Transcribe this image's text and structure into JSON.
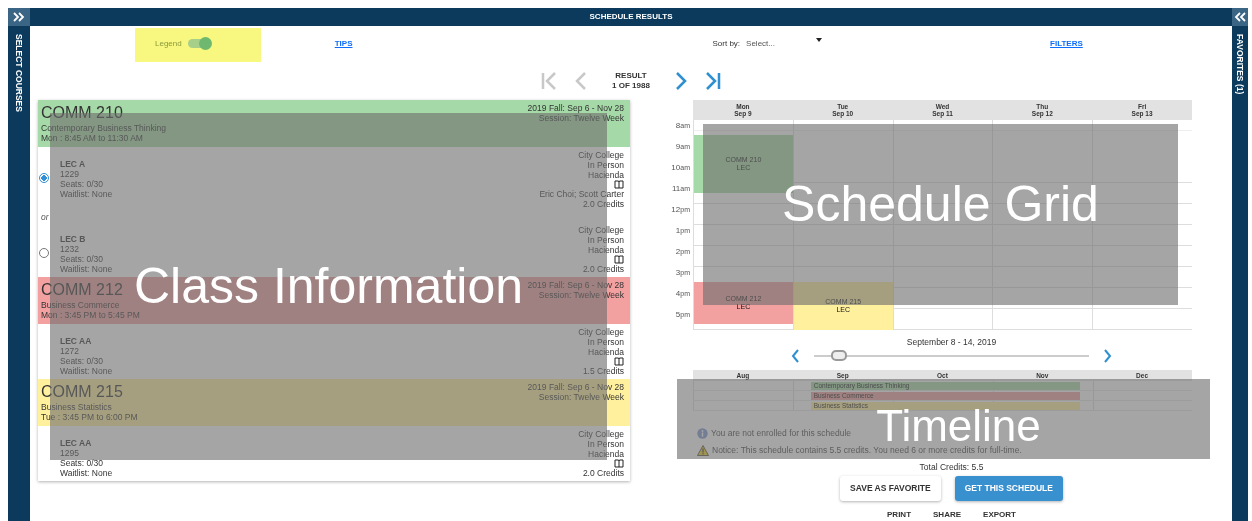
{
  "left_panel": {
    "label": "SELECT COURSES"
  },
  "header": {
    "title": "SCHEDULE RESULTS"
  },
  "right_panel": {
    "label": "FAVORITES (1)"
  },
  "toolbar": {
    "legend": {
      "label": "Legend",
      "on": true
    },
    "tips": "TIPS",
    "sort": {
      "label": "Sort by:",
      "placeholder": "Select..."
    },
    "filters": "FILTERS"
  },
  "pager": {
    "label": "RESULT",
    "count": "1 OF 1988",
    "buttons": [
      {
        "kind": "first",
        "disabled": true
      },
      {
        "kind": "prev",
        "disabled": true
      },
      {
        "kind": "next",
        "disabled": false
      },
      {
        "kind": "last",
        "disabled": false
      }
    ]
  },
  "courses": [
    {
      "code": "COMM 210",
      "title": "Contemporary Business Thinking",
      "time": "Mon : 8:45 AM to 11:30 AM",
      "term": "2019 Fall: Sep 6 - Nov 28",
      "session": "Session: Twelve Week",
      "color": "#a5d9a7",
      "or_label": "or",
      "sections": [
        {
          "name": "LEC A",
          "number": "1229",
          "seats": "Seats: 0/30",
          "waitlist": "Waitlist: None",
          "campus": "City College",
          "mode": "In Person",
          "location": "Hacienda",
          "instructors": "Eric Choi; Scott Carter",
          "credits": "2.0 Credits",
          "selected": true
        },
        {
          "name": "LEC B",
          "number": "1232",
          "seats": "Seats: 0/30",
          "waitlist": "Waitlist: None",
          "campus": "City College",
          "mode": "In Person",
          "location": "Hacienda",
          "credits": "2.0 Credits",
          "selected": false
        }
      ]
    },
    {
      "code": "COMM 212",
      "title": "Business Commerce",
      "time": "Mon : 3:45 PM to 5:45 PM",
      "term": "2019 Fall: Sep 6 - Nov 28",
      "session": "Session: Twelve Week",
      "color": "#f2a0a0",
      "sections": [
        {
          "name": "LEC AA",
          "number": "1272",
          "seats": "Seats: 0/30",
          "waitlist": "Waitlist: None",
          "campus": "City College",
          "mode": "In Person",
          "location": "Hacienda",
          "credits": "1.5 Credits"
        }
      ]
    },
    {
      "code": "COMM 215",
      "title": "Business Statistics",
      "time": "Tue : 3:45 PM to 6:00 PM",
      "term": "2019 Fall: Sep 6 - Nov 28",
      "session": "Session: Twelve Week",
      "color": "#fff09e",
      "sections": [
        {
          "name": "LEC AA",
          "number": "1295",
          "seats": "Seats: 0/30",
          "waitlist": "Waitlist: None",
          "campus": "City College",
          "mode": "In Person",
          "location": "Hacienda",
          "credits": "2.0 Credits"
        }
      ]
    }
  ],
  "schedule": {
    "days": [
      {
        "name": "Mon",
        "date": "Sep 9",
        "events": [
          {
            "label": "COMM 210",
            "type": "LEC",
            "color": "#a5d9a7"
          },
          {
            "label": "COMM 212",
            "type": "LEC",
            "color": "#f2a0a0"
          }
        ]
      },
      {
        "name": "Tue",
        "date": "Sep 10",
        "events": [
          {
            "label": "COMM 215",
            "type": "LEC",
            "color": "#fff09e"
          }
        ]
      },
      {
        "name": "Wed",
        "date": "Sep 11"
      },
      {
        "name": "Thu",
        "date": "Sep 12"
      },
      {
        "name": "Fri",
        "date": "Sep 13"
      }
    ],
    "hours": [
      {
        "hour": "8",
        "period": "am"
      },
      {
        "hour": "9",
        "period": "am"
      },
      {
        "hour": "10",
        "period": "am"
      },
      {
        "hour": "11",
        "period": "am"
      },
      {
        "hour": "12",
        "period": "pm"
      },
      {
        "hour": "1",
        "period": "pm"
      },
      {
        "hour": "2",
        "period": "pm"
      },
      {
        "hour": "3",
        "period": "pm"
      },
      {
        "hour": "4",
        "period": "pm"
      },
      {
        "hour": "5",
        "period": "pm"
      }
    ]
  },
  "week": {
    "label": "September 8 - 14, 2019",
    "level": 0.09
  },
  "timeline": {
    "months": [
      "Aug",
      "Sep",
      "Oct",
      "Nov",
      "Dec"
    ],
    "bars": [
      {
        "label": "Contemporary Business Thinking"
      },
      {
        "label": "Business Commerce"
      },
      {
        "label": "Business Statistics"
      }
    ]
  },
  "notices": [
    {
      "kind": "info",
      "text": "You are not enrolled for this schedule"
    },
    {
      "kind": "warning",
      "text": "Notice: This schedule contains 5.5 credits. You need 6 or more credits for full-time."
    }
  ],
  "total": "Total Credits: 5.5",
  "buttons": [
    {
      "label": "SAVE AS FAVORITE",
      "kind": "secondary"
    },
    {
      "label": "GET THIS SCHEDULE",
      "kind": "primary"
    }
  ],
  "links": [
    "PRINT",
    "SHARE",
    "EXPORT"
  ],
  "annotations": [
    {
      "label": "Class Information",
      "kind": "classes"
    },
    {
      "label": "Schedule Grid",
      "kind": "grid"
    },
    {
      "label": "Timeline",
      "kind": "timeline"
    }
  ]
}
